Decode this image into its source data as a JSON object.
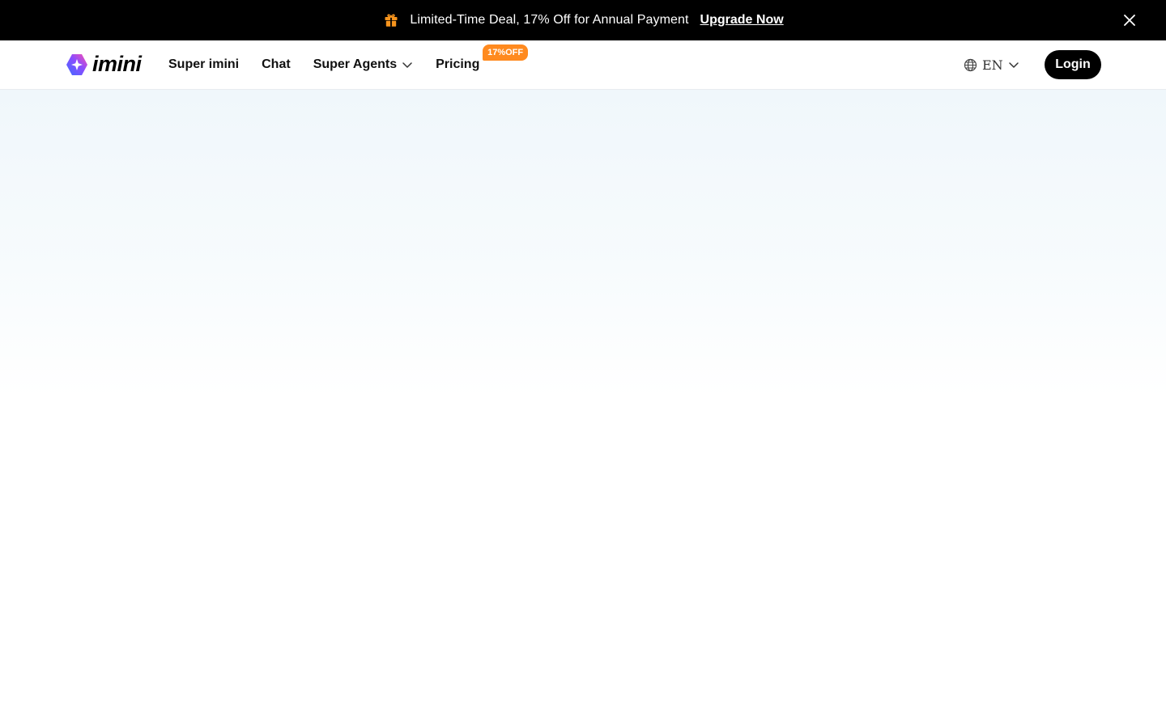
{
  "promo": {
    "icon": "gift-icon",
    "text": "Limited-Time Deal, 17% Off for Annual Payment",
    "link_label": "Upgrade Now",
    "close_icon": "close-icon",
    "accent": "#f7941d"
  },
  "header": {
    "logo_text": "imini",
    "nav": [
      {
        "label": "Super imini"
      },
      {
        "label": "Chat"
      },
      {
        "label": "Super Agents",
        "icon": "chevron-down-icon"
      },
      {
        "label": "Pricing",
        "badge": "17%OFF"
      }
    ],
    "language": {
      "icon": "globe-icon",
      "value": "EN"
    },
    "login_label": "Login"
  },
  "colors": {
    "banner_bg": "#000000",
    "badge_bg": "#ff8a1f",
    "login_bg": "#000000",
    "hero_tint": "#f0f7fb"
  }
}
